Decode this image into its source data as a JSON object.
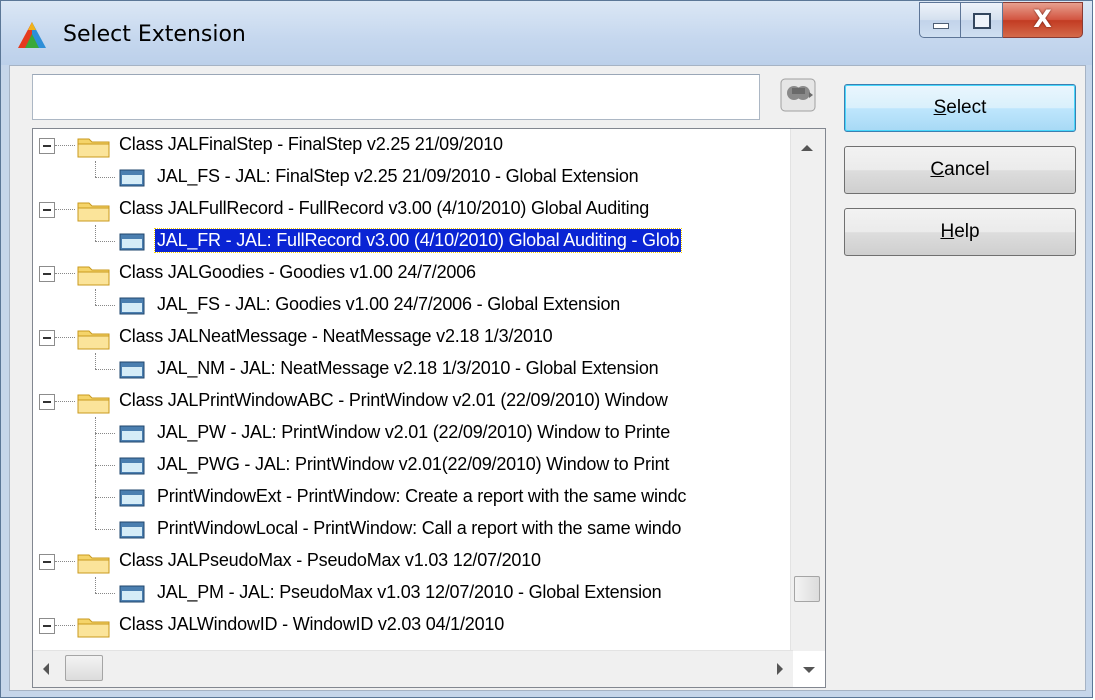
{
  "window": {
    "title": "Select Extension",
    "accent": "#0a24d4",
    "close_glyph": "X"
  },
  "search": {
    "value": "",
    "placeholder": ""
  },
  "tree": {
    "rows": [
      {
        "level": 0,
        "label": "Class JALFinalStep - FinalStep v2.25 21/09/2010"
      },
      {
        "level": 1,
        "label": "JAL_FS - JAL: FinalStep v2.25 21/09/2010 - Global Extension"
      },
      {
        "level": 0,
        "label": "Class JALFullRecord - FullRecord v3.00 (4/10/2010) Global Auditing"
      },
      {
        "level": 1,
        "label": "JAL_FR - JAL: FullRecord v3.00 (4/10/2010) Global Auditing - Glob",
        "selected": true
      },
      {
        "level": 0,
        "label": "Class JALGoodies - Goodies v1.00 24/7/2006"
      },
      {
        "level": 1,
        "label": "JAL_FS - JAL: Goodies v1.00 24/7/2006 - Global Extension"
      },
      {
        "level": 0,
        "label": "Class JALNeatMessage - NeatMessage v2.18 1/3/2010"
      },
      {
        "level": 1,
        "label": "JAL_NM - JAL: NeatMessage v2.18 1/3/2010 - Global Extension"
      },
      {
        "level": 0,
        "label": "Class JALPrintWindowABC - PrintWindow v2.01 (22/09/2010) Window"
      },
      {
        "level": 1,
        "label": "JAL_PW - JAL: PrintWindow v2.01 (22/09/2010) Window to Printe"
      },
      {
        "level": 1,
        "label": "JAL_PWG - JAL: PrintWindow v2.01(22/09/2010) Window to Print"
      },
      {
        "level": 1,
        "label": "PrintWindowExt - PrintWindow: Create a report with the same windc"
      },
      {
        "level": 1,
        "label": "PrintWindowLocal - PrintWindow: Call a report with the same windo"
      },
      {
        "level": 0,
        "label": "Class JALPseudoMax - PseudoMax v1.03 12/07/2010"
      },
      {
        "level": 1,
        "label": "JAL_PM - JAL: PseudoMax v1.03 12/07/2010 - Global Extension"
      },
      {
        "level": 0,
        "label": "Class JALWindowID - WindowID v2.03 04/1/2010"
      }
    ]
  },
  "buttons": {
    "select": {
      "accel": "S",
      "rest": "elect"
    },
    "cancel": {
      "accel": "C",
      "rest": "ancel"
    },
    "help": {
      "accel": "H",
      "rest": "elp"
    }
  },
  "icons": {
    "app": "triangle-logo-icon",
    "search": "search-icon",
    "folder": "folder-icon",
    "extension": "extension-icon"
  }
}
